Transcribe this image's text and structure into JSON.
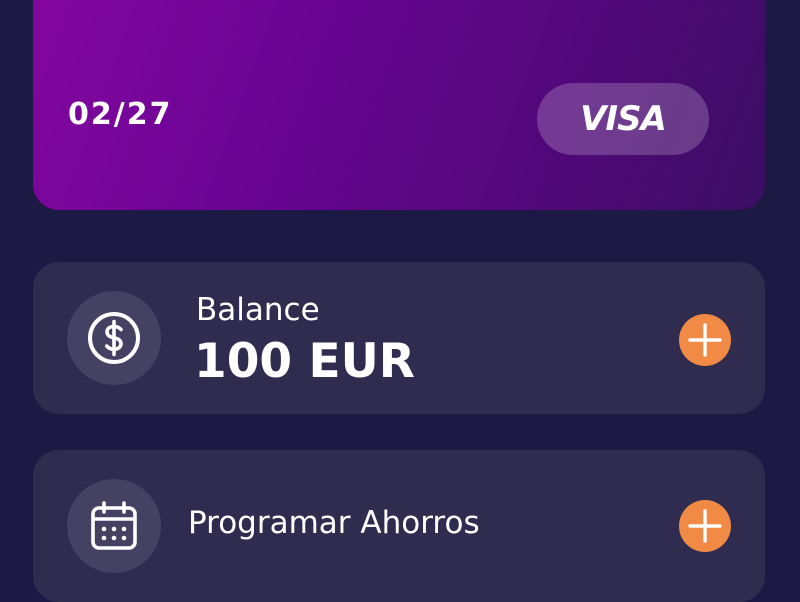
{
  "card": {
    "expiry": "02/27",
    "brand": "VISA",
    "gradient_colors": [
      "#84069f",
      "#52087a",
      "#3b0e63"
    ]
  },
  "balance": {
    "label": "Balance",
    "value": "100 EUR",
    "icon": "dollar-circle-icon",
    "action_icon": "plus-icon"
  },
  "savings": {
    "label": "Programar Ahorros",
    "icon": "calendar-icon",
    "action_icon": "plus-icon"
  },
  "colors": {
    "background": "#1c1944",
    "tile": "#302c4f",
    "icon_circle": "#454163",
    "accent": "#f08a45"
  }
}
